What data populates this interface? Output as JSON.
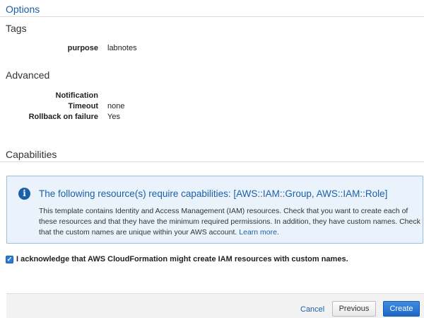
{
  "header": {
    "options_label": "Options"
  },
  "tags": {
    "title": "Tags",
    "rows": [
      {
        "key": "purpose",
        "value": "labnotes"
      }
    ]
  },
  "advanced": {
    "title": "Advanced",
    "rows": [
      {
        "key": "Notification",
        "value": ""
      },
      {
        "key": "Timeout",
        "value": "none"
      },
      {
        "key": "Rollback on failure",
        "value": "Yes"
      }
    ]
  },
  "capabilities": {
    "title": "Capabilities",
    "info": {
      "icon": "info-icon",
      "title": "The following resource(s) require capabilities: [AWS::IAM::Group, AWS::IAM::Role]",
      "line1": "This template contains Identity and Access Management (IAM) resources. Check that you want to create each of",
      "line2": "these resources and that they have the minimum required permissions. In addition, they have custom names. Check",
      "line3": "that the custom names are unique within your AWS account.",
      "link": "Learn more."
    },
    "acknowledge": {
      "checked": true,
      "label": "I acknowledge that AWS CloudFormation might create IAM resources with custom names."
    }
  },
  "footer": {
    "cancel": "Cancel",
    "previous": "Previous",
    "create": "Create"
  },
  "colors": {
    "accent": "#1a5fa8",
    "info_bg": "#eaf3fb",
    "primary_button": "#2d7cd6"
  }
}
